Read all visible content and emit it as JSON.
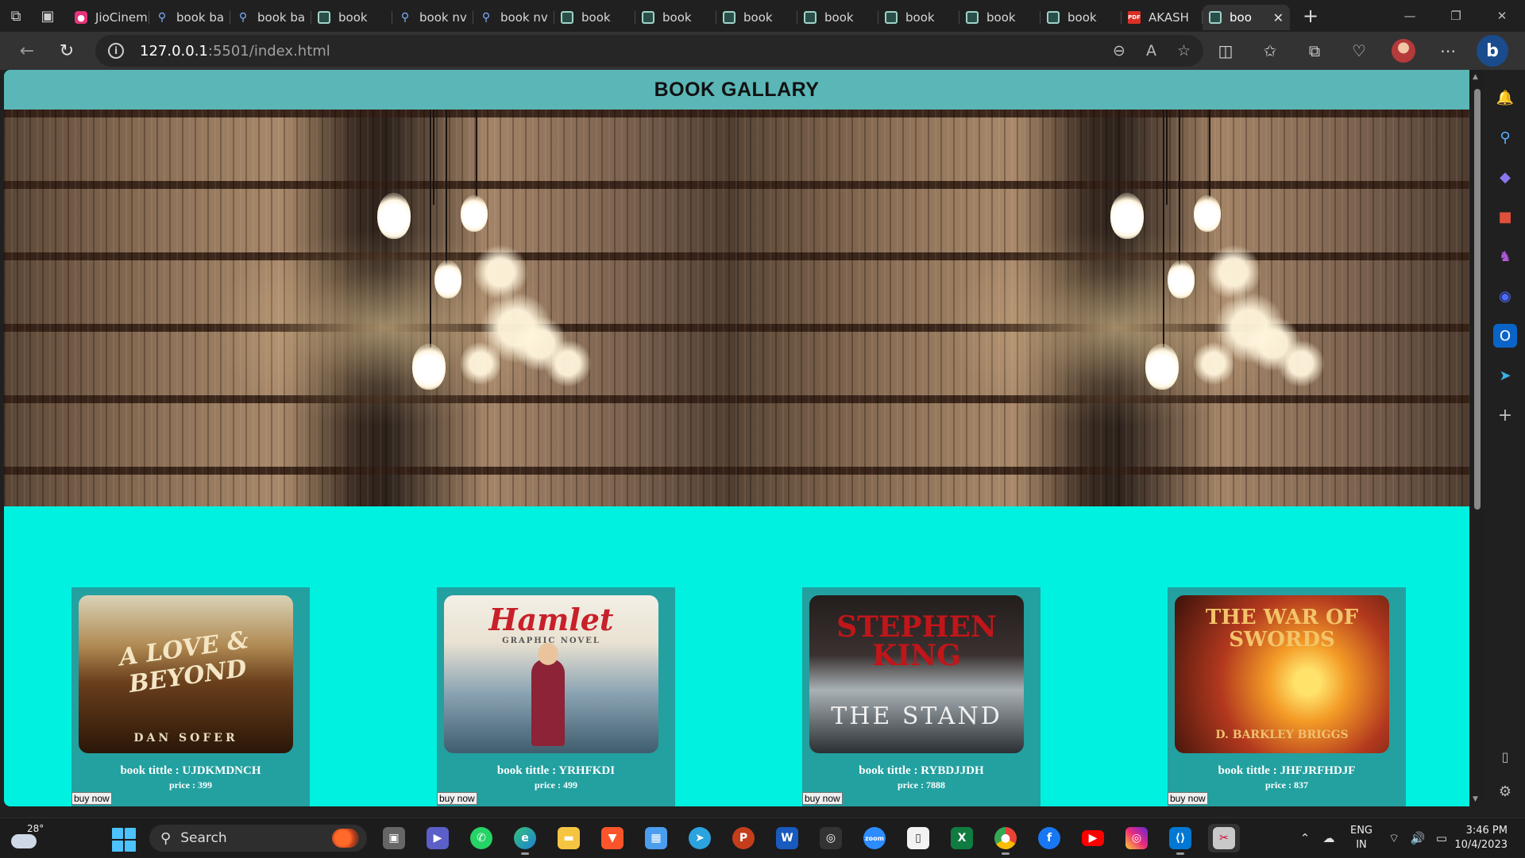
{
  "browser": {
    "tabs": [
      {
        "title": "JioCinem",
        "favicon": "jio-icon",
        "active": false
      },
      {
        "title": "book ba",
        "favicon": "search-icon",
        "active": false
      },
      {
        "title": "book ba",
        "favicon": "search-icon",
        "active": false
      },
      {
        "title": "book",
        "favicon": "page-icon",
        "active": false
      },
      {
        "title": "book nv",
        "favicon": "search-icon",
        "active": false
      },
      {
        "title": "book nv",
        "favicon": "search-icon",
        "active": false
      },
      {
        "title": "book",
        "favicon": "page-icon",
        "active": false
      },
      {
        "title": "book",
        "favicon": "page-icon",
        "active": false
      },
      {
        "title": "book",
        "favicon": "page-icon",
        "active": false
      },
      {
        "title": "book",
        "favicon": "page-icon",
        "active": false
      },
      {
        "title": "book",
        "favicon": "page-icon",
        "active": false
      },
      {
        "title": "book",
        "favicon": "page-icon",
        "active": false
      },
      {
        "title": "book",
        "favicon": "page-icon",
        "active": false
      },
      {
        "title": "AKASH",
        "favicon": "pdf-icon",
        "active": false
      },
      {
        "title": "boo",
        "favicon": "page-icon",
        "active": true
      }
    ],
    "close_tab_glyph": "✕",
    "new_tab_glyph": "+",
    "window_controls": [
      "—",
      "❐",
      "✕"
    ],
    "url_host": "127.0.0.1",
    "url_rest": ":5501/index.html"
  },
  "page": {
    "title": "BOOK GALLARY",
    "cards": [
      {
        "title": "book tittle : UJDKMDNCH",
        "price": "price : 399",
        "buy_label": "buy now",
        "cover": "A LOVE & BEYOND",
        "cover_author": "DAN SOFER"
      },
      {
        "title": "book tittle : YRHFKDI",
        "price": "price : 499",
        "buy_label": "buy now",
        "cover": "Hamlet",
        "cover_author": "GRAPHIC NOVEL"
      },
      {
        "title": "book tittle : RYBDJJDH",
        "price": "price : 7888",
        "buy_label": "buy now",
        "cover": "STEPHEN KING",
        "cover_author": "THE STAND"
      },
      {
        "title": "book tittle : JHFJRFHDJF",
        "price": "price : 837",
        "buy_label": "buy now",
        "cover": "THE WAR OF SWORDS",
        "cover_author": "D. BARKLEY BRIGGS"
      }
    ]
  },
  "taskbar": {
    "temperature": "28°",
    "search_placeholder": "Search",
    "lang_line1": "ENG",
    "lang_line2": "IN",
    "time": "3:46 PM",
    "date": "10/4/2023"
  },
  "colors": {
    "page_background": "#00f1e0",
    "header_bar": "#5bb6b7",
    "card_background": "#23a0a0"
  }
}
